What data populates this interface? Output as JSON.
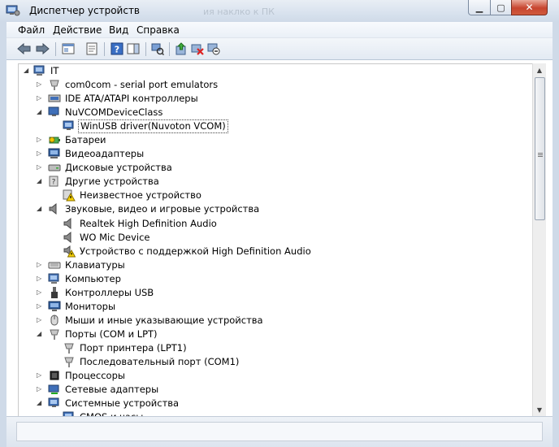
{
  "window": {
    "title": "Диспетчер устройств",
    "ghost_text": "ия наклко к ПК",
    "min_glyph": "▁",
    "max_glyph": "▢",
    "close_glyph": "✕"
  },
  "menu": [
    "Файл",
    "Действие",
    "Вид",
    "Справка"
  ],
  "toolbar_icons": [
    "back-arrow-icon",
    "forward-arrow-icon",
    "properties-icon",
    "show-hide-console-icon",
    "help-icon",
    "action-pane-icon",
    "scan-hardware-icon",
    "update-driver-icon",
    "uninstall-icon",
    "disable-device-icon"
  ],
  "tree": {
    "root": "IT",
    "nodes": [
      {
        "label": "com0com - serial port emulators",
        "icon": "serial-port-icon",
        "state": "collapsed"
      },
      {
        "label": "IDE ATA/ATAPI контроллеры",
        "icon": "ide-controller-icon",
        "state": "collapsed"
      },
      {
        "label": "NuVCOMDeviceClass",
        "icon": "device-class-icon",
        "state": "expanded"
      },
      {
        "label": "WinUSB driver(Nuvoton VCOM)",
        "icon": "usb-device-icon",
        "state": "leaf",
        "selected": true
      },
      {
        "label": "Батареи",
        "icon": "battery-icon",
        "state": "collapsed"
      },
      {
        "label": "Видеоадаптеры",
        "icon": "display-adapter-icon",
        "state": "collapsed"
      },
      {
        "label": "Дисковые устройства",
        "icon": "disk-drive-icon",
        "state": "collapsed"
      },
      {
        "label": "Другие устройства",
        "icon": "other-devices-icon",
        "state": "expanded"
      },
      {
        "label": "Неизвестное устройство",
        "icon": "unknown-device-warning-icon",
        "state": "leaf"
      },
      {
        "label": "Звуковые, видео и игровые устройства",
        "icon": "speaker-icon",
        "state": "expanded"
      },
      {
        "label": "Realtek High Definition Audio",
        "icon": "speaker-icon",
        "state": "leaf"
      },
      {
        "label": "WO Mic Device",
        "icon": "speaker-icon",
        "state": "leaf"
      },
      {
        "label": "Устройство с поддержкой High Definition Audio",
        "icon": "speaker-warning-icon",
        "state": "leaf"
      },
      {
        "label": "Клавиатуры",
        "icon": "keyboard-icon",
        "state": "collapsed"
      },
      {
        "label": "Компьютер",
        "icon": "computer-icon",
        "state": "collapsed"
      },
      {
        "label": "Контроллеры USB",
        "icon": "usb-icon",
        "state": "collapsed"
      },
      {
        "label": "Мониторы",
        "icon": "monitor-icon",
        "state": "collapsed"
      },
      {
        "label": "Мыши и иные указывающие устройства",
        "icon": "mouse-icon",
        "state": "collapsed"
      },
      {
        "label": "Порты (COM и LPT)",
        "icon": "port-icon",
        "state": "expanded"
      },
      {
        "label": "Порт принтера (LPT1)",
        "icon": "port-icon",
        "state": "leaf"
      },
      {
        "label": "Последовательный порт (COM1)",
        "icon": "port-icon",
        "state": "leaf"
      },
      {
        "label": "Процессоры",
        "icon": "processor-icon",
        "state": "collapsed"
      },
      {
        "label": "Сетевые адаптеры",
        "icon": "network-adapter-icon",
        "state": "collapsed"
      },
      {
        "label": "Системные устройства",
        "icon": "system-devices-icon",
        "state": "expanded"
      },
      {
        "label": "CMOS и часы",
        "icon": "system-devices-icon",
        "state": "leaf"
      }
    ]
  },
  "scrollbar": {
    "up": "▲",
    "down": "▼"
  },
  "glyphs": {
    "expanded": "◢",
    "collapsed": "▷"
  }
}
